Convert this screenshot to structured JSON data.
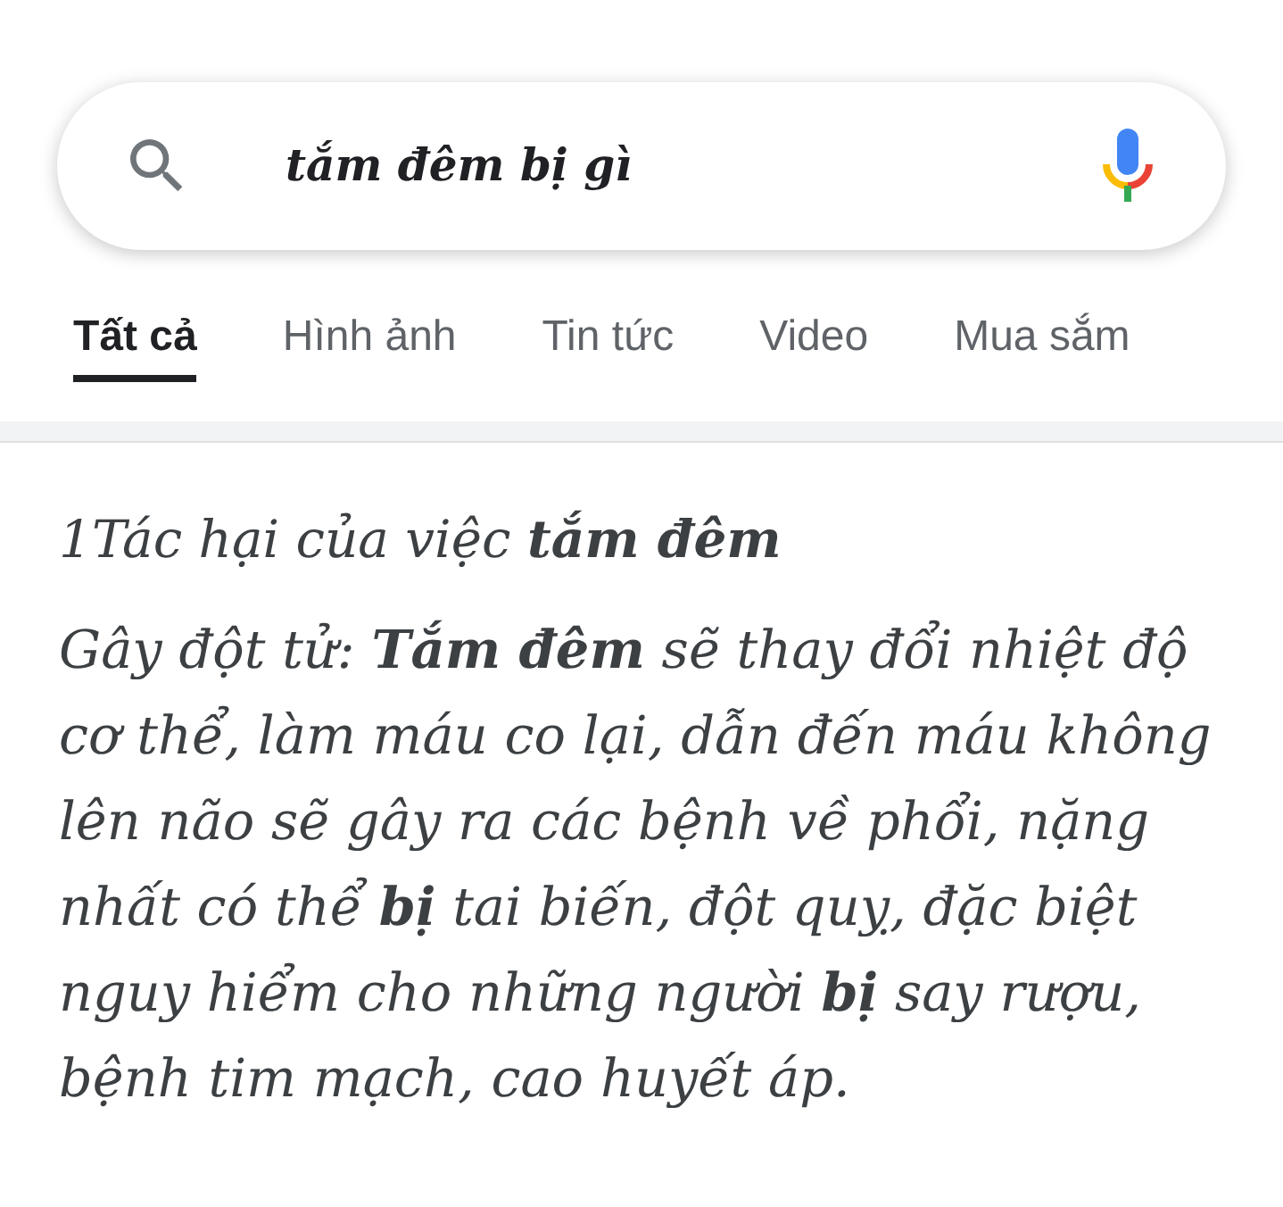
{
  "search": {
    "value": "tắm đêm bị gì"
  },
  "tabs": [
    {
      "label": "Tất cả",
      "selected": true
    },
    {
      "label": "Hình ảnh",
      "selected": false
    },
    {
      "label": "Tin tức",
      "selected": false
    },
    {
      "label": "Video",
      "selected": false
    },
    {
      "label": "Mua sắm",
      "selected": false
    }
  ],
  "result": {
    "heading": "1Tác hại của việc **tắm đêm**",
    "paragraph": "Gây đột tử: **Tắm đêm** sẽ thay đổi nhiệt độ cơ thể, làm máu co lại, dẫn đến máu không lên não sẽ gây ra các bệnh về phổi, nặng nhất có thể **bị** tai biến, đột quỵ, đặc biệt nguy hiểm cho những người **bị** say rượu, bệnh tim mạch, cao huyết áp."
  }
}
